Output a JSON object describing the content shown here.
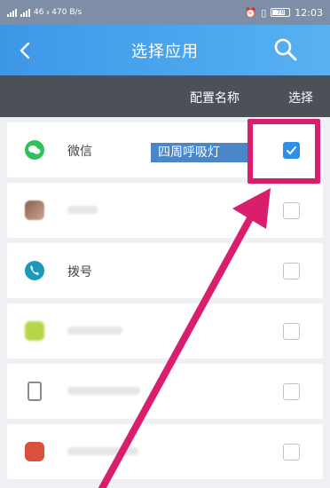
{
  "status_bar": {
    "left_text": "46 ᵢₗ 470 B/s",
    "right_icons": [
      "alarm-icon",
      "vibrate-icon",
      "battery-icon"
    ],
    "battery": "78",
    "time": "12:03"
  },
  "header": {
    "title": "选择应用",
    "back_icon": "back-arrow-icon",
    "search_icon": "search-icon"
  },
  "columns": {
    "config_name": "配置名称",
    "select": "选择"
  },
  "apps": [
    {
      "name": "微信",
      "icon": "wechat-icon",
      "icon_color": "#2dc25a",
      "config": "四周呼吸灯",
      "checked": true
    },
    {
      "name": "",
      "icon": "blurred-app-icon",
      "icon_color": "#9e7d6e",
      "config": "",
      "checked": false
    },
    {
      "name": "拨号",
      "icon": "phone-icon",
      "icon_color": "#1a9ab8",
      "config": "",
      "checked": false
    },
    {
      "name": "",
      "icon": "blurred-app-icon",
      "icon_color": "#b6d64a",
      "config": "",
      "checked": false
    },
    {
      "name": "",
      "icon": "sim-card-icon",
      "icon_color": "#8a8a8a",
      "config": "",
      "checked": false
    },
    {
      "name": "",
      "icon": "blurred-app-icon",
      "icon_color": "#d9503d",
      "config": "",
      "checked": false
    }
  ],
  "colors": {
    "header_gradient_start": "#3d97e6",
    "header_gradient_end": "#57b1f2",
    "column_bar": "#4b5059",
    "checkbox_checked": "#2f8fe6",
    "annotation": "#d81e6c"
  }
}
